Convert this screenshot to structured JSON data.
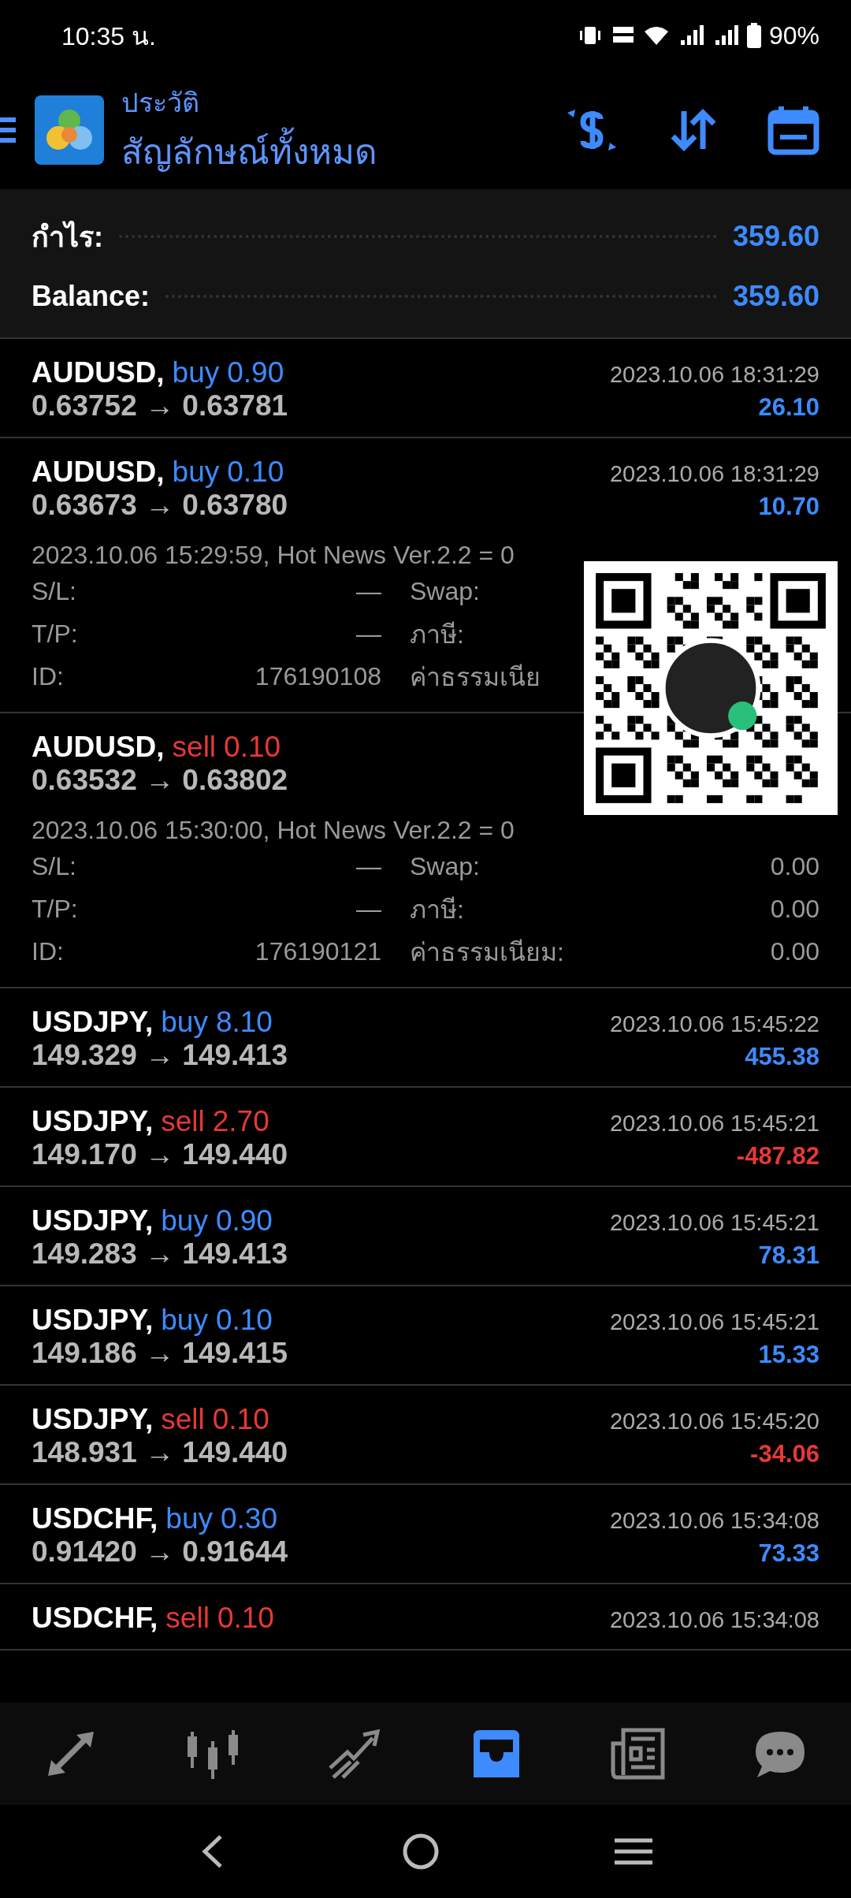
{
  "status_bar": {
    "time": "10:35 น.",
    "battery": "90%"
  },
  "header": {
    "title": "ประวัติ",
    "subtitle": "สัญลักษณ์ทั้งหมด"
  },
  "summary": [
    {
      "label": "กำไร:",
      "value": "359.60"
    },
    {
      "label": "Balance:",
      "value": "359.60"
    }
  ],
  "trades": [
    {
      "symbol": "AUDUSD,",
      "kind": "buy",
      "side": "buy",
      "volume": "0.90",
      "prices": "0.63752 → 0.63781",
      "time": "2023.10.06 18:31:29",
      "profit": "26.10",
      "loss": false
    },
    {
      "symbol": "AUDUSD,",
      "kind": "buy",
      "side": "buy",
      "volume": "0.10",
      "prices": "0.63673 → 0.63780",
      "time": "2023.10.06 18:31:29",
      "profit": "10.70",
      "loss": false,
      "comment": "2023.10.06 15:29:59, Hot News Ver.2.2 = 0",
      "details": [
        {
          "label": "S/L:",
          "value": "—",
          "label2": "Swap:"
        },
        {
          "label": "T/P:",
          "value": "—",
          "label2": "ภาษี:"
        },
        {
          "label": "ID:",
          "value": "176190108",
          "label2": "ค่าธรรมเนีย"
        }
      ]
    },
    {
      "symbol": "AUDUSD,",
      "kind": "sell",
      "side": "sell",
      "volume": "0.10",
      "prices": "0.63532 → 0.63802",
      "comment": "2023.10.06 15:30:00, Hot News Ver.2.2 = 0",
      "details": [
        {
          "label": "S/L:",
          "value": "—",
          "label2": "Swap:",
          "value2": "0.00"
        },
        {
          "label": "T/P:",
          "value": "—",
          "label2": "ภาษี:",
          "value2": "0.00"
        },
        {
          "label": "ID:",
          "value": "176190121",
          "label2": "ค่าธรรมเนียม:",
          "value2": "0.00"
        }
      ]
    },
    {
      "symbol": "USDJPY,",
      "kind": "buy",
      "side": "buy",
      "volume": "8.10",
      "prices": "149.329 → 149.413",
      "time": "2023.10.06 15:45:22",
      "profit": "455.38",
      "loss": false
    },
    {
      "symbol": "USDJPY,",
      "kind": "sell",
      "side": "sell",
      "volume": "2.70",
      "prices": "149.170 → 149.440",
      "time": "2023.10.06 15:45:21",
      "profit": "-487.82",
      "loss": true
    },
    {
      "symbol": "USDJPY,",
      "kind": "buy",
      "side": "buy",
      "volume": "0.90",
      "prices": "149.283 → 149.413",
      "time": "2023.10.06 15:45:21",
      "profit": "78.31",
      "loss": false
    },
    {
      "symbol": "USDJPY,",
      "kind": "buy",
      "side": "buy",
      "volume": "0.10",
      "prices": "149.186 → 149.415",
      "time": "2023.10.06 15:45:21",
      "profit": "15.33",
      "loss": false
    },
    {
      "symbol": "USDJPY,",
      "kind": "sell",
      "side": "sell",
      "volume": "0.10",
      "prices": "148.931 → 149.440",
      "time": "2023.10.06 15:45:20",
      "profit": "-34.06",
      "loss": true
    },
    {
      "symbol": "USDCHF,",
      "kind": "buy",
      "side": "buy",
      "volume": "0.30",
      "prices": "0.91420 → 0.91644",
      "time": "2023.10.06 15:34:08",
      "profit": "73.33",
      "loss": false
    },
    {
      "symbol": "USDCHF,",
      "kind": "sell",
      "side": "sell",
      "volume": "0.10",
      "time": "2023.10.06 15:34:08"
    }
  ],
  "overlay": {
    "kind": "qr-code"
  },
  "bottom_nav": [
    {
      "kind": "quotes",
      "selected": false
    },
    {
      "kind": "chart",
      "selected": false
    },
    {
      "kind": "trade",
      "selected": false
    },
    {
      "kind": "history",
      "selected": true
    },
    {
      "kind": "news",
      "selected": false
    },
    {
      "kind": "chat",
      "selected": false
    }
  ]
}
